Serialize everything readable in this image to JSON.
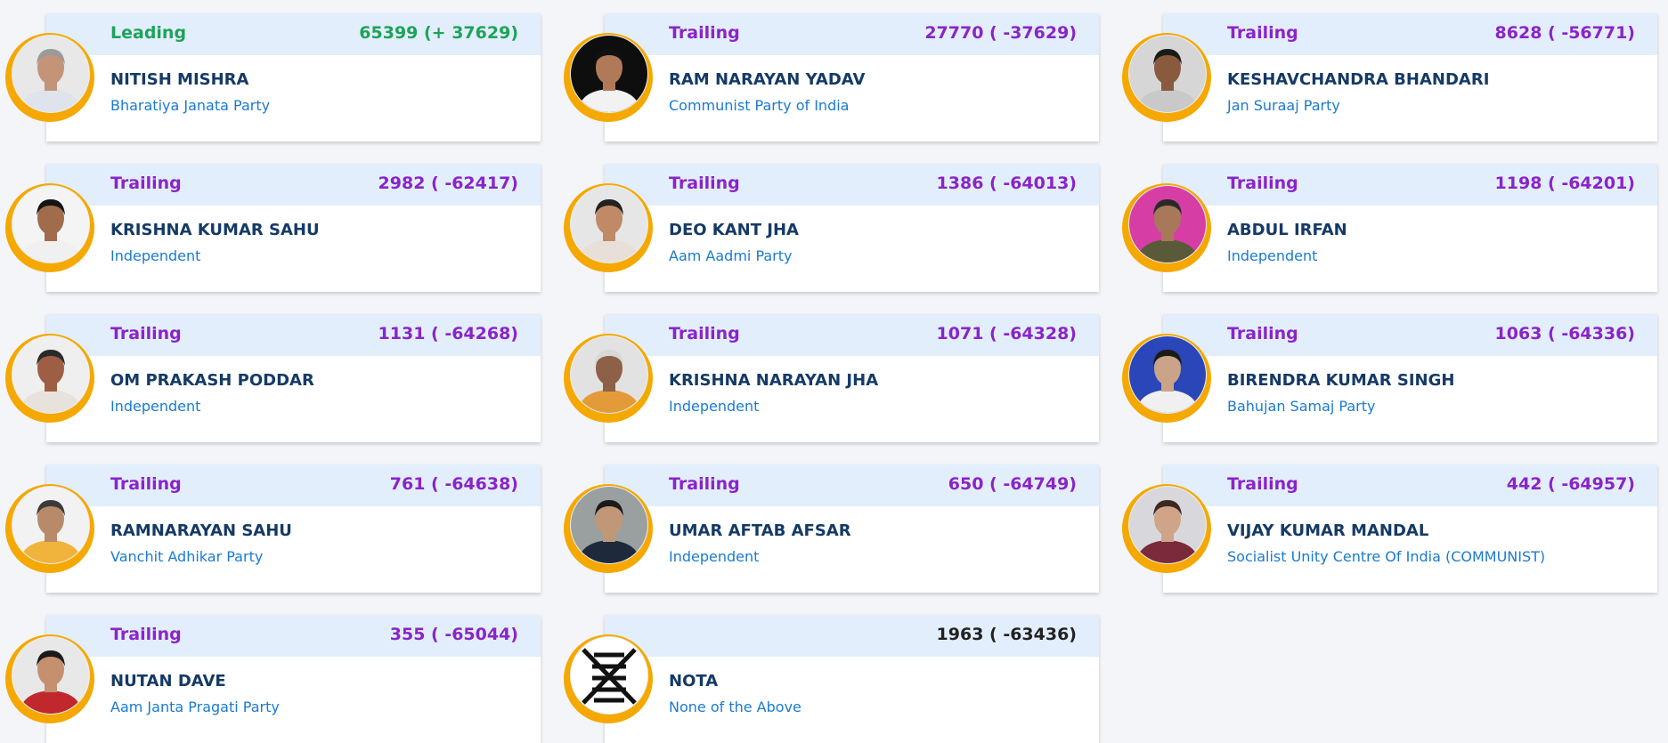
{
  "candidates": [
    {
      "status": "Leading",
      "votes": "65399 (+ 37629)",
      "name": "NITISH MISHRA",
      "party": "Bharatiya Janata Party",
      "photo": {
        "bg": "#e8e8e8",
        "skin": "#c49478",
        "shirt": "#dfe3ec",
        "hair": "#9a9a9a"
      }
    },
    {
      "status": "Trailing",
      "votes": "27770 ( -37629)",
      "name": "RAM NARAYAN YADAV",
      "party": "Communist Party of India",
      "photo": {
        "bg": "#0e0e0e",
        "skin": "#b07a58",
        "shirt": "#f2f2f2",
        "hair": "#111111"
      }
    },
    {
      "status": "Trailing",
      "votes": "8628 ( -56771)",
      "name": "KESHAVCHANDRA BHANDARI",
      "party": "Jan Suraaj Party",
      "photo": {
        "bg": "#d6d6d6",
        "skin": "#8a5a3e",
        "shirt": "#c9c9c9",
        "hair": "#1a1a1a"
      }
    },
    {
      "status": "Trailing",
      "votes": "2982 ( -62417)",
      "name": "KRISHNA KUMAR SAHU",
      "party": "Independent",
      "photo": {
        "bg": "#f4f4f4",
        "skin": "#a06c4c",
        "shirt": "#f0f0f0",
        "hair": "#151515"
      }
    },
    {
      "status": "Trailing",
      "votes": "1386 ( -64013)",
      "name": "DEO KANT JHA",
      "party": "Aam Aadmi Party",
      "photo": {
        "bg": "#e6e6e6",
        "skin": "#c08a66",
        "shirt": "#e8e0d8",
        "hair": "#222222"
      }
    },
    {
      "status": "Trailing",
      "votes": "1198 ( -64201)",
      "name": "ABDUL IRFAN",
      "party": "Independent",
      "photo": {
        "bg": "#d63ea6",
        "skin": "#a8785a",
        "shirt": "#5a5a3a",
        "hair": "#2a2a2a"
      }
    },
    {
      "status": "Trailing",
      "votes": "1131 ( -64268)",
      "name": "OM PRAKASH PODDAR",
      "party": "Independent",
      "photo": {
        "bg": "#efefef",
        "skin": "#9e5e44",
        "shirt": "#e8e2dc",
        "hair": "#2a2a2a"
      }
    },
    {
      "status": "Trailing",
      "votes": "1071 ( -64328)",
      "name": "KRISHNA NARAYAN JHA",
      "party": "Independent",
      "photo": {
        "bg": "#e2e2e2",
        "skin": "#8e6048",
        "shirt": "#e39b3a",
        "hair": "#d8d8d8"
      }
    },
    {
      "status": "Trailing",
      "votes": "1063 ( -64336)",
      "name": "BIRENDRA KUMAR SINGH",
      "party": "Bahujan Samaj Party",
      "photo": {
        "bg": "#2a46b8",
        "skin": "#caa488",
        "shirt": "#f0f0f0",
        "hair": "#1a1a1a"
      }
    },
    {
      "status": "Trailing",
      "votes": "761 ( -64638)",
      "name": "RAMNARAYAN SAHU",
      "party": "Vanchit Adhikar Party",
      "photo": {
        "bg": "#f2f2f2",
        "skin": "#b88a6a",
        "shirt": "#f0b43c",
        "hair": "#3a3a3a"
      }
    },
    {
      "status": "Trailing",
      "votes": "650 ( -64749)",
      "name": "UMAR AFTAB AFSAR",
      "party": "Independent",
      "photo": {
        "bg": "#9aa0a0",
        "skin": "#c09878",
        "shirt": "#1e2a3c",
        "hair": "#1a1a1a"
      }
    },
    {
      "status": "Trailing",
      "votes": "442 ( -64957)",
      "name": "VIJAY KUMAR MANDAL",
      "party": "Socialist Unity Centre Of India (COMMUNIST)",
      "photo": {
        "bg": "#d8d8dc",
        "skin": "#d0a488",
        "shirt": "#7a2a3a",
        "hair": "#3a2a20"
      }
    },
    {
      "status": "Trailing",
      "votes": "355 ( -65044)",
      "name": "NUTAN DAVE",
      "party": "Aam Janta Pragati Party",
      "photo": {
        "bg": "#e8e8e8",
        "skin": "#c4906e",
        "shirt": "#c0282e",
        "hair": "#1a1a1a"
      }
    },
    {
      "status": "",
      "votes": "1963 ( -63436)",
      "name": "NOTA",
      "party": "None of the Above",
      "photo": null
    }
  ],
  "colors": {
    "leading": "#1ea35a",
    "trailing": "#8a24c9",
    "ring": "#f5a800",
    "header_bg": "#e2eefb",
    "name": "#153a66",
    "party": "#1a7ad2"
  },
  "icons": {
    "nota": "nota-icon"
  }
}
